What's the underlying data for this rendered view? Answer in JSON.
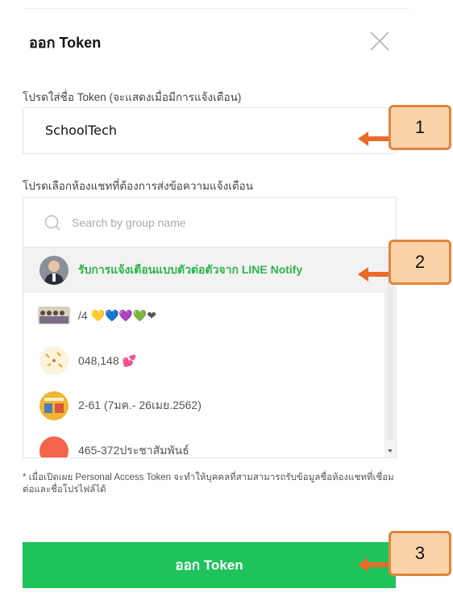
{
  "dialog": {
    "title": "ออก Token",
    "token_name_label": "โปรดใส่ชื่อ Token (จะแสดงเมื่อมีการแจ้งเตือน)",
    "token_name_value": "SchoolTech",
    "chat_select_label": "โปรดเลือกห้องแชทที่ต้องการส่งข้อความแจ้งเตือน",
    "search_placeholder": "Search by group name",
    "chats": [
      {
        "label": "รับการแจ้งเตือนแบบตัวต่อตัวจาก LINE Notify",
        "selected": true,
        "avatar": "person-photo"
      },
      {
        "label": "/4 💛💙💜💚❤",
        "selected": false,
        "avatar": "group-photo"
      },
      {
        "label": "048,148 💕",
        "selected": false,
        "avatar": "doodle-image"
      },
      {
        "label": "2-61 (7มค.- 26เมย.2562)",
        "selected": false,
        "avatar": "poster-image"
      },
      {
        "label": "465-372ประชาสัมพันธ์",
        "selected": false,
        "avatar": "red-circle"
      }
    ],
    "disclaimer": "* เมื่อเปิดเผย Personal Access Token จะทำให้บุคคลที่สามสามารถรับข้อมูลชื่อห้องแชทที่เชื่อมต่อและชื่อโปรไฟล์ได้",
    "submit_label": "ออก Token"
  },
  "callouts": [
    "1",
    "2",
    "3"
  ],
  "colors": {
    "accent_green": "#1ec35b",
    "callout_fill": "#fbd3a8",
    "callout_border": "#e0853f",
    "arrow": "#ea6a2a"
  }
}
